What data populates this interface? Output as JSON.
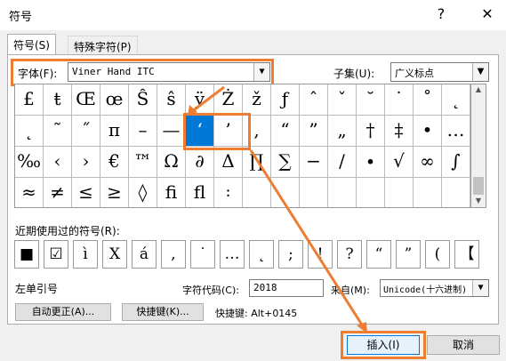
{
  "window": {
    "title": "符号",
    "help_label": "?",
    "close_label": "✕"
  },
  "tabs": [
    {
      "label": "符号(S)"
    },
    {
      "label": "特殊字符(P)"
    }
  ],
  "font": {
    "label": "字体(F):",
    "value": "Viner Hand ITC"
  },
  "subset": {
    "label": "子集(U):",
    "value": "广义标点"
  },
  "symbols": [
    [
      "£",
      "ŧ",
      "Œ",
      "œ",
      "Ŝ",
      "ŝ",
      "ÿ",
      "Ż",
      "ž",
      "ƒ",
      "ˆ",
      "ˇ",
      "˘",
      "˙",
      "˚",
      "˛"
    ],
    [
      "˛",
      "˜",
      "˝",
      "π",
      "–",
      "—",
      "‘",
      "’",
      ",",
      "“",
      "”",
      "„",
      "†",
      "‡",
      "•",
      "…"
    ],
    [
      "‰",
      "‹",
      "›",
      "€",
      "™",
      "Ω",
      "∂",
      "Δ",
      "∏",
      "∑",
      "−",
      "∕",
      "∙",
      "√",
      "∞",
      "∫"
    ],
    [
      "≈",
      "≠",
      "≤",
      "≥",
      "◊",
      "ﬁ",
      "ﬂ",
      "꞉",
      "",
      "",
      "",
      "",
      "",
      "",
      "",
      ""
    ]
  ],
  "selected_symbol": "‘",
  "recent": {
    "label": "近期使用过的符号(R):",
    "symbols": [
      "■",
      "☑",
      "ì",
      "X",
      "á",
      ",",
      "˙",
      "…",
      "˛",
      ";",
      "!",
      "?",
      "“",
      "”",
      "(",
      "【"
    ]
  },
  "char_info": {
    "name": "左单引号",
    "code_label": "字符代码(C):",
    "code_value": "2018",
    "from_label": "来自(M):",
    "from_value": "Unicode(十六进制)"
  },
  "buttons": {
    "autocorrect": "自动更正(A)...",
    "shortcut": "快捷键(K)...",
    "shortcut_text": "快捷键: Alt+0145",
    "insert": "插入(I)",
    "cancel": "取消"
  },
  "colors": {
    "highlight": "#ed7d31",
    "selection": "#0078d7"
  }
}
